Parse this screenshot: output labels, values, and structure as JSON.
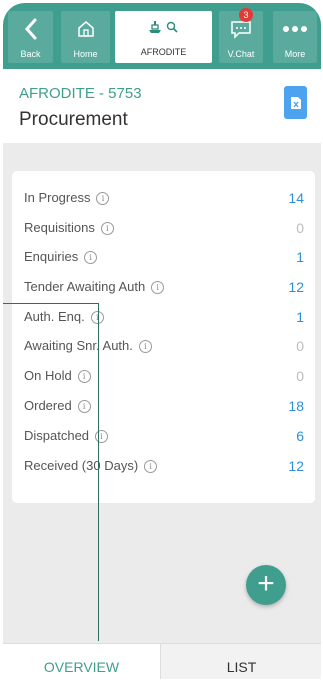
{
  "nav": {
    "back": "Back",
    "home": "Home",
    "vessel": "AFRODITE",
    "vchat": "V.Chat",
    "vchat_badge": "3",
    "more": "More"
  },
  "header": {
    "vessel_code": "AFRODITE - 5753",
    "title": "Procurement"
  },
  "stats": [
    {
      "label": "In Progress",
      "count": "14",
      "color": "#2d8fd8"
    },
    {
      "label": "Requisitions",
      "count": "0",
      "color": "#bbbbbb"
    },
    {
      "label": "Enquiries",
      "count": "1",
      "color": "#2d8fd8"
    },
    {
      "label": "Tender Awaiting Auth",
      "count": "12",
      "color": "#2d8fd8"
    },
    {
      "label": "Auth. Enq.",
      "count": "1",
      "color": "#2d8fd8"
    },
    {
      "label": "Awaiting Snr. Auth.",
      "count": "0",
      "color": "#bbbbbb"
    },
    {
      "label": "On Hold",
      "count": "0",
      "color": "#bbbbbb"
    },
    {
      "label": "Ordered",
      "count": "18",
      "color": "#2d8fd8"
    },
    {
      "label": "Dispatched",
      "count": "6",
      "color": "#2d8fd8"
    },
    {
      "label": "Received (30 Days)",
      "count": "12",
      "color": "#2d8fd8"
    }
  ],
  "fab": "+",
  "tabs": {
    "overview": "OVERVIEW",
    "list": "LIST"
  },
  "colors": {
    "brand": "#3f9e8d",
    "accent": "#2d8fd8"
  }
}
